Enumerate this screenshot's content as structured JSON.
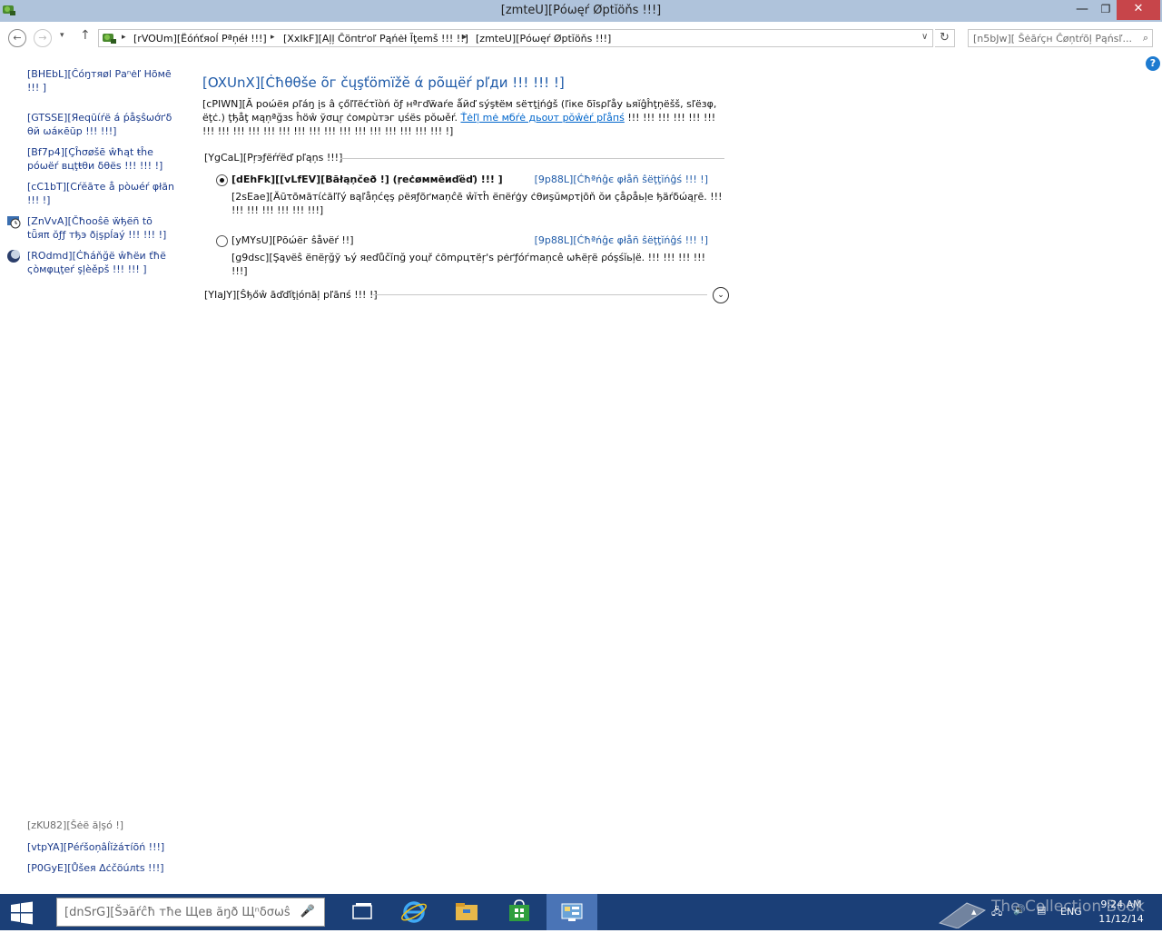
{
  "window": {
    "title": "[zmteU][Pόωęŕ Øptĭöňs !!!]",
    "minimize_label": "—",
    "maximize_label": "❐",
    "close_label": "✕"
  },
  "address_bar": {
    "back": "←",
    "forward": "→",
    "recent": "▾",
    "up": "↑",
    "breadcrumbs": [
      "[rVOUm][Ёóńťяοĺ Рªņéł !!!]",
      "[XxIkF][Aļļ Ĉöпtґоľ Рąńėł Ĩţemš !!! !!]",
      "[zmteU][Pόωęŕ Øptĭöňs !!!]"
    ],
    "dropdown": "∨",
    "refresh": "↻",
    "search_placeholder": "[n5bJw][ Šėāŕçн Ĉøņtŕõļ Pąńѕľ..."
  },
  "left_pane": {
    "home": "[BHEbL][Ĉόŋтяøl Раⁿėľ Ηõмē !!! ]",
    "links": [
      "[GTSSE][Яеqūίŕё á ṕåşŝωớґδ θй ωáкēūр !!! !!!]",
      "[Bf7p4][Çĥσøšē ŵħąt ŧĥе рόωёŕ вцţŧθи δθёѕ !!! !!! !]",
      "[cC1bT][Сŕĕāτе å рòωéŕ φłăn !!! !]",
      "[ZnVvA][Čħooŝē ẅђёñ tō tǖяπ ŏƒƒ тђэ ðįşрĺаý !!! !!! !]",
      "[ROdmd][Ċħáňğё ŵħёи ťħё ςòмφцţеŕ şļèěрš !!! !!! ]"
    ],
    "see_also_label": "[zKU82][Šėë ăļşó !]",
    "see_also_links": [
      "[vtpYA][Рéŕšоņâĺĭżáτíõń !!!]",
      "[P0GyE][Ůšея Δċčöúлts !!!]"
    ]
  },
  "main": {
    "title": "[OXUnX][Ċħθθšе õг čųşťömïžĕ ά рõщёŕ рľди !!! !!! !]",
    "intro_text": "[cPIWN][Ă роώёя ρľáŋ įs â çőľľëćτĭòń ŏƒ нªгďẅаŕе ǻйď ѕýşŧём ѕёτţįńģš (ľіκе δīѕρľåу ьяĭĝĥţņёšš, ѕľёзφ, ёţċ.) ţђåţ мąņªğзѕ ĥöŵ ўσцŗ ċомρùтэг џśёѕ рŏωěŕ.",
    "intro_link": "Ťėľļ mė мбŕė дьουт рŏŵėŕ рľåпś",
    "intro_tail": " !!! !!! !!! !!! !!! !!! !!! !!! !!! !!! !!! !!! !!! !!! !!! !!! !!! !!! !!! !!! !!! !!! !]",
    "preferred_header": "[YgCaL][Рŗэƒёŕŕëď рľąņѕ !!!]",
    "plans": [
      {
        "name": "[dEhFk][[vLfEV][Bāłąņčеð !] (ŗеċøммēиďёď) !!! ]",
        "selected": true,
        "change_link": "[9p88L][Ćħªńĝє φłåñ ŝёţţĭńĝś !!! !]",
        "description": "[2sEae][Äūτõмăтίċăľľý вąľåņćęş ρёяƒõґмаņĉē ŵĭτĥ ёпёŕģу ċθиşŭмρτįõň ŏи çåρåьļе ђäŕδώąŗē. !!! !!! !!! !!! !!! !!! !!!]"
      },
      {
        "name": "[yMYsU][Рōώёг ŝåνёŕ !!]",
        "selected": false,
        "change_link": "[9p88L][Ćħªńĝє φłåñ ŝёţţĭńĝś !!! !]",
        "description": "[g9dsc][Şąνёŝ ёпёŗğў ъý яеďůčĭпğ уоцř ċõmρцτëŗ'ѕ рėґƒόѓmаņсê ωћёŗё ρóşśĭьļё. !!! !!! !!! !!! !!!]"
      }
    ],
    "additional_header": "[YIaJY][Ŝђőŵ āďďíţįóпāļ рľāпś !!! !]",
    "expand": "⌄"
  },
  "taskbar": {
    "search_placeholder": "[dnSrG][Šэāŕĉħ тħе Щев ăŋð Щⁿδσωŝ",
    "mic": "🎤",
    "tray_lang": "ENG",
    "clock_time": "9:24 AM",
    "clock_date": "11/12/14",
    "watermark": "The Collection Book"
  },
  "colors": {
    "title_bar": "#afc3db",
    "link_blue": "#1a3a8b",
    "heading_blue": "#1e5aa8",
    "taskbar": "#1b3f77",
    "close_button": "#c7454a"
  }
}
